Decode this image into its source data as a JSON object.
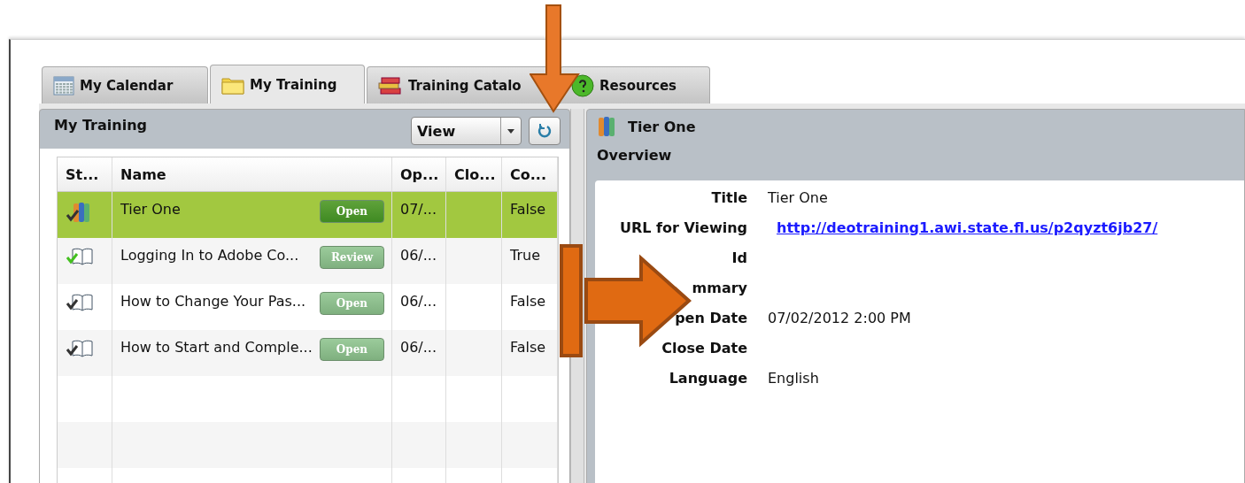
{
  "tabs": [
    {
      "label": "My Calendar",
      "selected": false
    },
    {
      "label": "My Training",
      "selected": true
    },
    {
      "label": "Training Catalo",
      "selected": false
    },
    {
      "label": "Resources",
      "selected": false
    }
  ],
  "list_panel": {
    "title": "My Training",
    "view_select": {
      "value": "View"
    },
    "columns": [
      "St...",
      "Name",
      "Op...",
      "Clo...",
      "Co..."
    ],
    "rows": [
      {
        "kind": "collection",
        "name": "Tier One",
        "action": "Open",
        "open": "07/...",
        "close": "",
        "completed": "False",
        "selected": true
      },
      {
        "kind": "done",
        "name": "Logging In to Adobe Co...",
        "action": "Review",
        "open": "06/...",
        "close": "",
        "completed": "True",
        "selected": false
      },
      {
        "kind": "pending",
        "name": "How to Change Your Pas...",
        "action": "Open",
        "open": "06/...",
        "close": "",
        "completed": "False",
        "selected": false
      },
      {
        "kind": "pending",
        "name": "How to Start and Comple...",
        "action": "Open",
        "open": "06/...",
        "close": "",
        "completed": "False",
        "selected": false
      }
    ]
  },
  "detail_panel": {
    "title": "Tier One",
    "section": "Overview",
    "fields": [
      {
        "label": "Title",
        "value": "Tier One",
        "kind": "text"
      },
      {
        "label": "URL for Viewing",
        "value": "http://deotraining1.awi.state.fl.us/p2qyzt6jb27/",
        "kind": "link"
      },
      {
        "label": "Id",
        "kind": "text"
      },
      {
        "label": "mmary",
        "kind": "text"
      },
      {
        "label": "pen Date",
        "value": "07/02/2012 2:00 PM",
        "kind": "text"
      },
      {
        "label": "Close Date",
        "kind": "text"
      },
      {
        "label": "Language",
        "value": "English",
        "kind": "text"
      }
    ]
  }
}
